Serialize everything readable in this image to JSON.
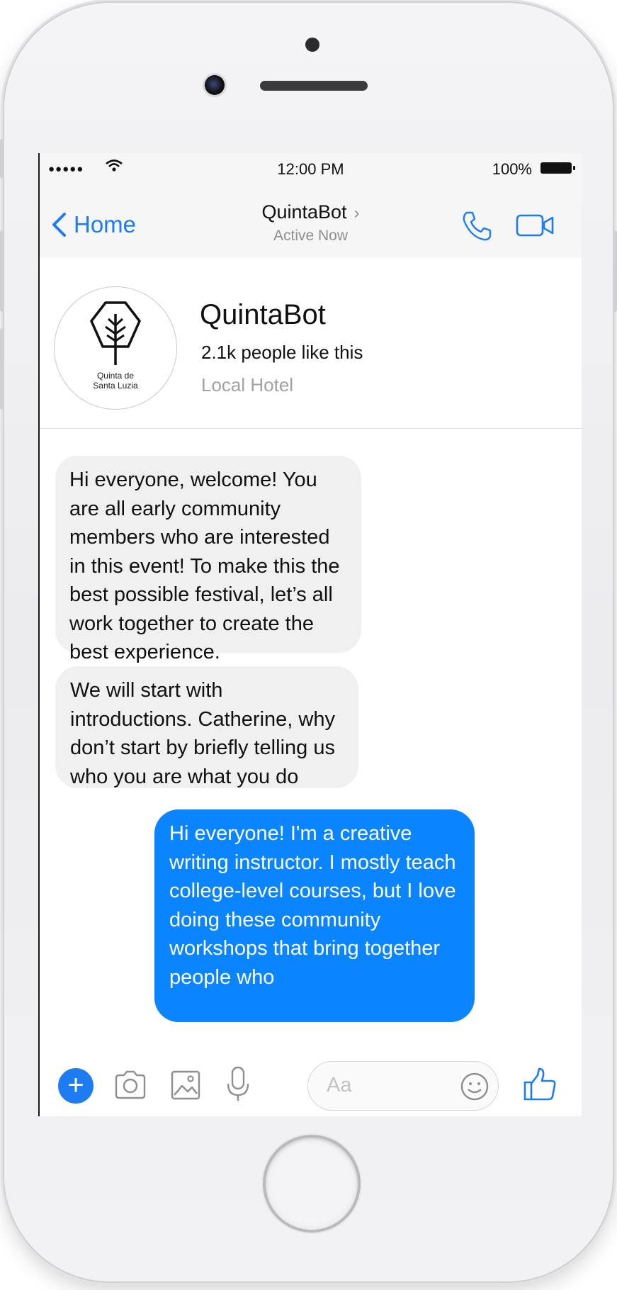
{
  "statusbar": {
    "signal": "●●●●●",
    "time": "12:00 PM",
    "battery": "100%"
  },
  "navbar": {
    "back_label": "Home",
    "title": "QuintaBot",
    "title_chevron": "›",
    "subtitle": "Active Now",
    "call_icon": "phone-icon",
    "video_icon": "video-camera-icon"
  },
  "profile": {
    "logo_text_line1": "Quinta de",
    "logo_text_line2": "Santa Luzia",
    "name": "QuintaBot",
    "likes": "2.1k people like this",
    "category": "Local Hotel"
  },
  "messages": [
    {
      "from": "bot",
      "text": "Hi everyone, welcome! You are all early community members who are interested in this event! To make this the best possible festival, let’s all work together to create the best experience."
    },
    {
      "from": "bot",
      "text": "We will start with introductions. Catherine, why don’t start by briefly telling us who you are what you do"
    },
    {
      "from": "user",
      "text": "Hi everyone! I'm a creative writing instructor. I mostly teach college-level courses, but I love doing these community workshops that bring together people who"
    }
  ],
  "composer": {
    "placeholder": "Aa",
    "icons": [
      "plus-icon",
      "camera-icon",
      "image-icon",
      "microphone-icon",
      "emoji-icon",
      "thumbs-up-icon"
    ]
  },
  "colors": {
    "accent": "#1e7cf2",
    "outgoing_bubble": "#0a84ff",
    "incoming_bubble": "#f0f0f0",
    "secondary_text": "#8e8e93"
  }
}
